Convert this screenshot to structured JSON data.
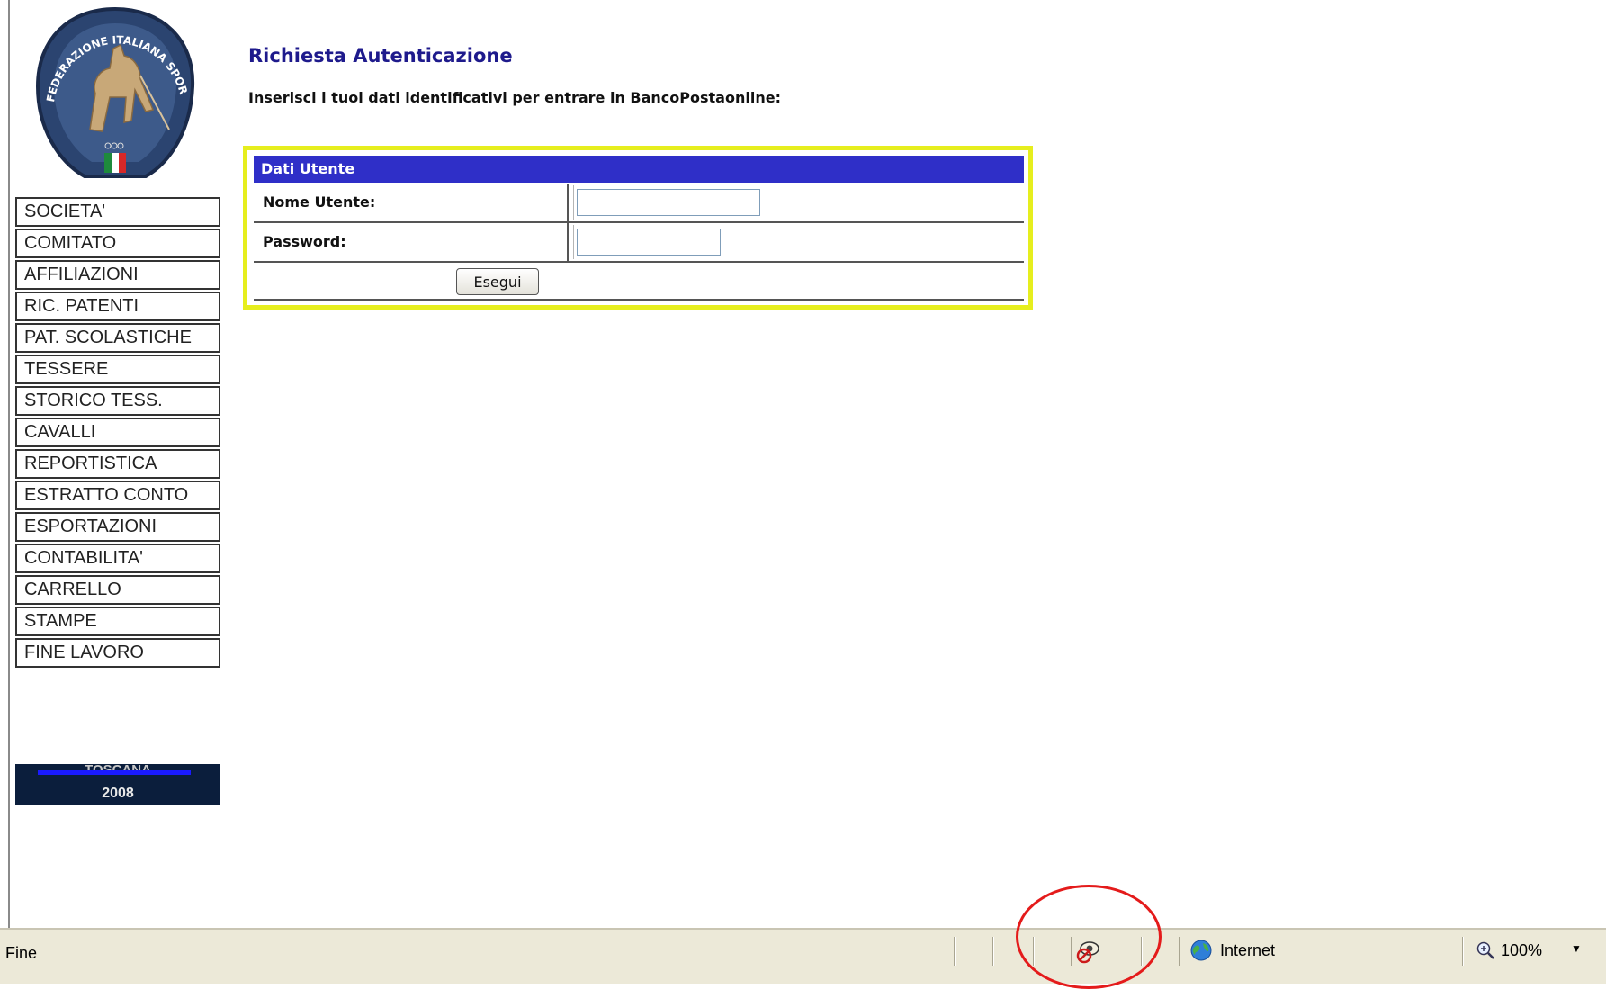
{
  "page": {
    "title": "Richiesta Autenticazione",
    "instructions": "Inserisci i tuoi dati identificativi per entrare in BancoPostaonline:"
  },
  "logo": {
    "text": "FEDERAZIONE ITALIANA SPORT EQUESTRI"
  },
  "menu": {
    "items": [
      {
        "label": "SOCIETA'"
      },
      {
        "label": "COMITATO"
      },
      {
        "label": "AFFILIAZIONI"
      },
      {
        "label": "RIC. PATENTI"
      },
      {
        "label": "PAT. SCOLASTICHE"
      },
      {
        "label": "TESSERE"
      },
      {
        "label": "STORICO TESS."
      },
      {
        "label": "CAVALLI"
      },
      {
        "label": "REPORTISTICA"
      },
      {
        "label": "ESTRATTO CONTO"
      },
      {
        "label": "ESPORTAZIONI"
      },
      {
        "label": "CONTABILITA'"
      },
      {
        "label": "CARRELLO"
      },
      {
        "label": "STAMPE"
      },
      {
        "label": "FINE LAVORO"
      }
    ]
  },
  "banner": {
    "region": "TOSCANA",
    "year": "2008"
  },
  "login": {
    "header": "Dati Utente",
    "username_label": "Nome Utente:",
    "username_value": "",
    "password_label": "Password:",
    "password_value": "",
    "submit_label": "Esegui"
  },
  "statusbar": {
    "status_text": "Fine",
    "zone_label": "Internet",
    "zoom_label": "100%",
    "icons": [
      "privacy-icon",
      "globe-icon",
      "zoom-icon",
      "chevron-down-icon"
    ]
  },
  "colors": {
    "title": "#1e1a8c",
    "login_header_bg": "#2f2fc8",
    "login_border": "#e6ee1e",
    "banner_bg": "#0b1e3c",
    "annotation": "#e41b1b",
    "statusbar_bg": "#ece9d8"
  }
}
